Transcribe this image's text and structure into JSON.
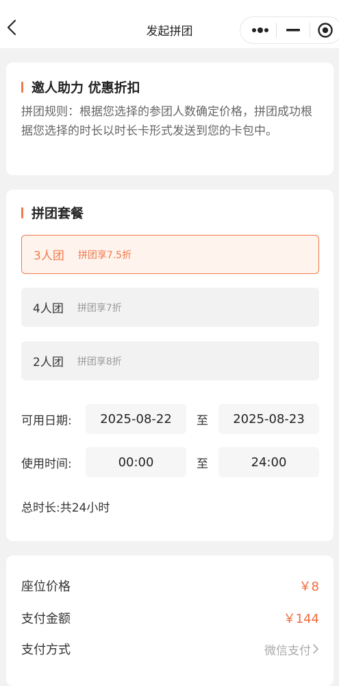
{
  "navbar": {
    "title": "发起拼团"
  },
  "rules": {
    "title": "邀人助力 优惠折扣",
    "text": "拼团规则：根据您选择的参团人数确定价格，拼团成功根据您选择的时长以时长卡形式发送到您的卡包中。"
  },
  "packages": {
    "title": "拼团套餐",
    "options": [
      {
        "name": "3人团",
        "discount": "拼团享7.5折",
        "selected": true
      },
      {
        "name": "4人团",
        "discount": "拼团享7折",
        "selected": false
      },
      {
        "name": "2人团",
        "discount": "拼团享8折",
        "selected": false
      }
    ],
    "date_label": "可用日期:",
    "date_start": "2025-08-22",
    "date_end": "2025-08-23",
    "time_label": "使用时间:",
    "time_start": "00:00",
    "time_end": "24:00",
    "range_sep": "至",
    "duration_label": "总时长:",
    "duration_value": "共24小时"
  },
  "payment": {
    "seat_price_label": "座位价格",
    "seat_price_value": "￥8",
    "pay_amount_label": "支付金额",
    "pay_amount_value": "￥144",
    "pay_method_label": "支付方式",
    "pay_method_value": "微信支付"
  },
  "colors": {
    "accent": "#f07a4a",
    "price": "#f06a3a",
    "background": "#f2f2f2"
  }
}
